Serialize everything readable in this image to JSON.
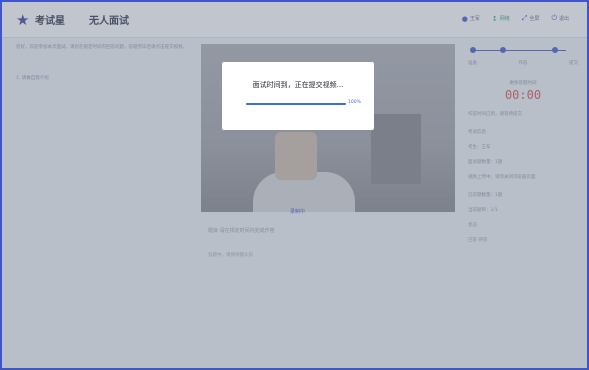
{
  "topbar": {
    "logo_text": "考试星",
    "page_title": "无人面试",
    "items": [
      {
        "icon": "user-icon",
        "label": "王军"
      },
      {
        "icon": "signal-icon",
        "label": "网络"
      },
      {
        "icon": "fullscreen-icon",
        "label": "全屏"
      },
      {
        "icon": "exit-icon",
        "label": "退出"
      }
    ]
  },
  "left_panel": {
    "description": "您好，欢迎参加本次面试。请您在规定时间内回答问题，答题完毕后请点击提交视频。",
    "question_hint": "1. 请做自我介绍"
  },
  "video": {
    "recording_label": "录制中",
    "caption_main": "题目 请在规定时间内完成作答",
    "caption_sub": "答题中，请保持镜头前"
  },
  "right_panel": {
    "steps": [
      "准备",
      "作答",
      "提交"
    ],
    "timer_label": "剩余答题时间",
    "timer_value": "00:00",
    "lines": [
      "作答时间已到，请等待提交",
      "考试信息",
      "考生：王军",
      "面试题数量：1题",
      "视频上传中，请勿关闭浏览器页面",
      "已答题数量：1题",
      "当前题目：1/1",
      "状态",
      "已答  待答"
    ]
  },
  "modal": {
    "title": "面试时间到，正在提交视频...",
    "progress_percent": 100,
    "progress_text": "100%"
  },
  "colors": {
    "accent": "#3a57c6",
    "progress": "#3a6fd8",
    "timer": "#d34b4b",
    "overlay": "rgba(120,128,145,0.42)"
  }
}
